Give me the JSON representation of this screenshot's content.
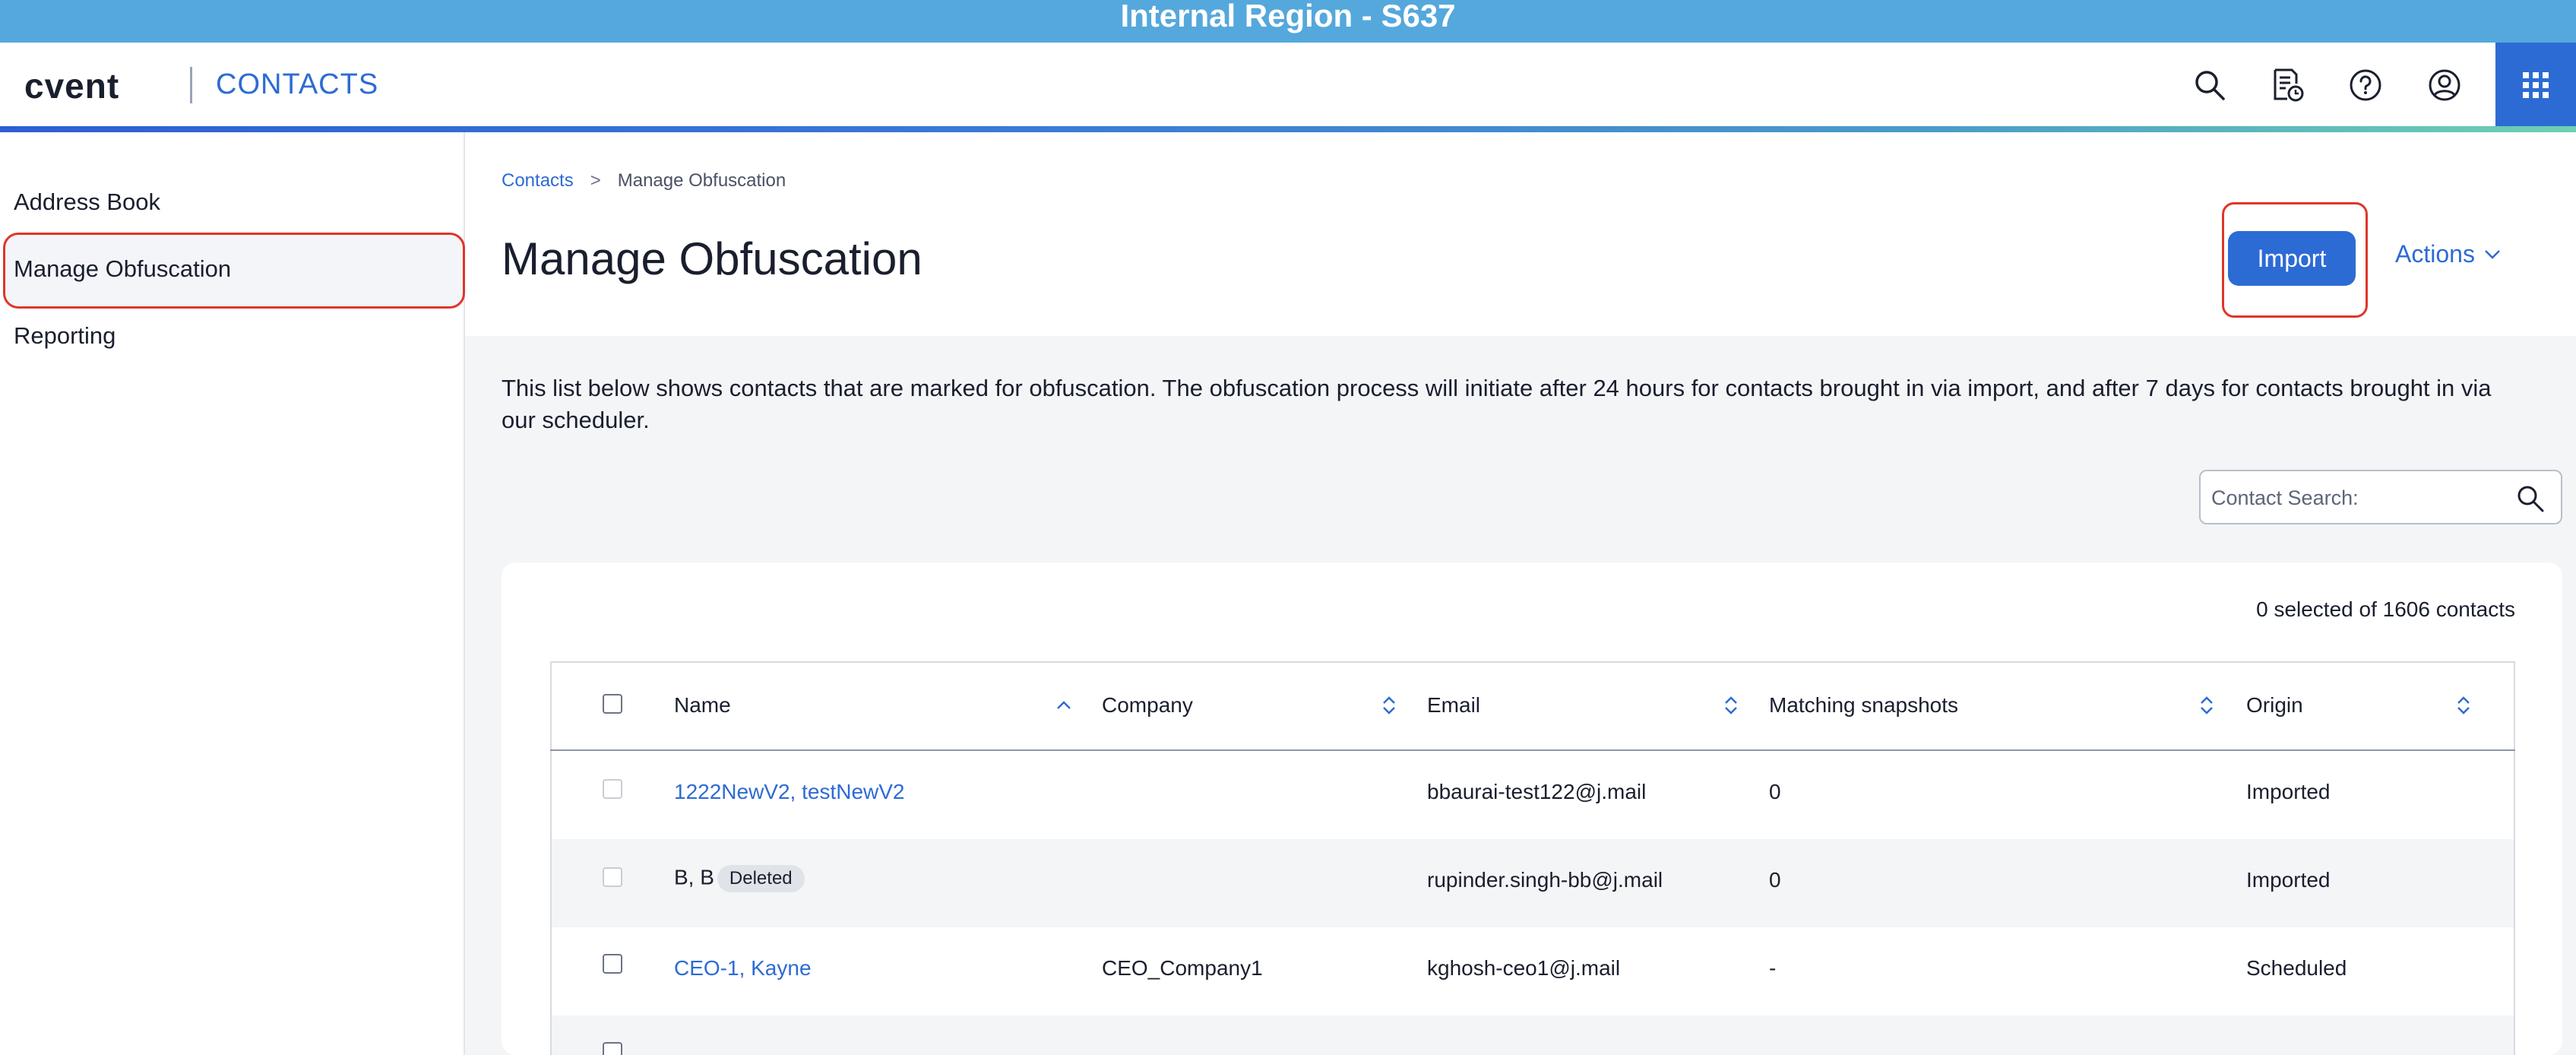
{
  "banner": {
    "text": "Internal Region - S637"
  },
  "header": {
    "logo": "cvent",
    "app_name": "CONTACTS",
    "icons": [
      "search-icon",
      "reports-icon",
      "help-icon",
      "profile-icon",
      "apps-grid-icon"
    ]
  },
  "sidebar": {
    "items": [
      {
        "label": "Address Book"
      },
      {
        "label": "Manage Obfuscation",
        "active": true
      },
      {
        "label": "Reporting"
      }
    ]
  },
  "breadcrumb": {
    "parent": "Contacts",
    "separator": ">",
    "current": "Manage Obfuscation"
  },
  "page": {
    "title": "Manage Obfuscation",
    "import_label": "Import",
    "actions_label": "Actions",
    "description": "This list below shows contacts that are marked for obfuscation. The obfuscation process will initiate after 24 hours for contacts brought in via import, and after 7 days for contacts brought in via our scheduler."
  },
  "search": {
    "placeholder": "Contact Search:",
    "value": ""
  },
  "table": {
    "selected_summary": "0 selected of 1606 contacts",
    "columns": [
      {
        "label": "Name",
        "sort": "asc"
      },
      {
        "label": "Company",
        "sort": "none"
      },
      {
        "label": "Email",
        "sort": "none"
      },
      {
        "label": "Matching snapshots",
        "sort": "none"
      },
      {
        "label": "Origin",
        "sort": "none"
      }
    ],
    "rows": [
      {
        "name": "1222NewV2, testNewV2",
        "name_is_link": true,
        "badge": "",
        "company": "",
        "email": "bbaurai-test122@j.mail",
        "snapshots": "0",
        "origin": "Imported",
        "checkbox_disabled": true
      },
      {
        "name": "B, B",
        "name_is_link": false,
        "badge": "Deleted",
        "company": "",
        "email": "rupinder.singh-bb@j.mail",
        "snapshots": "0",
        "origin": "Imported",
        "checkbox_disabled": true
      },
      {
        "name": "CEO-1, Kayne",
        "name_is_link": true,
        "badge": "",
        "company": "CEO_Company1",
        "email": "kghosh-ceo1@j.mail",
        "snapshots": "-",
        "origin": "Scheduled",
        "checkbox_disabled": false
      }
    ]
  },
  "colors": {
    "banner": "#55a8dc",
    "accent": "#2d6bd4",
    "highlight": "#e0352b"
  }
}
